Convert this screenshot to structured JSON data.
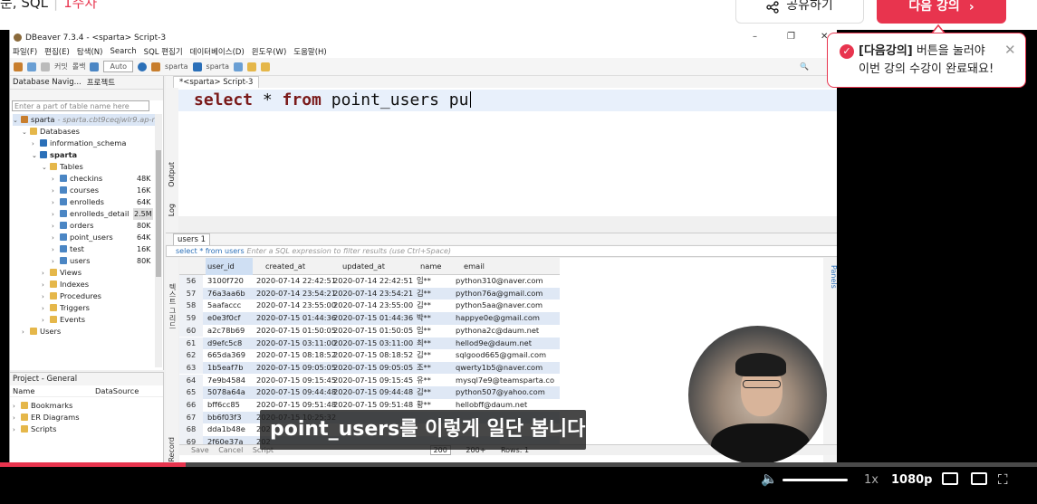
{
  "top": {
    "course_title": "문, SQL",
    "duration": "1주차",
    "share_label": "공유하기",
    "next_label": "다음 강의",
    "next_arrow": "›"
  },
  "dbeaver": {
    "window_title": "DBeaver 7.3.4 - <sparta> Script-3",
    "menu": [
      "파일(F)",
      "편집(E)",
      "탐색(N)",
      "Search",
      "SQL 편집기",
      "데이터베이스(D)",
      "윈도우(W)",
      "도움말(H)"
    ],
    "toolbar": {
      "undo": "커밋",
      "redo": "롤백",
      "auto_mode": "Auto",
      "connection": "sparta",
      "database": "sparta"
    },
    "nav_tab_label": "Database Navig...",
    "project_tab_label": "프로젝트",
    "filter_placeholder": "Enter a part of table name here",
    "tree": {
      "connection": "sparta",
      "connection_host": "- sparta.cbt9ceqjwlr9.ap-no",
      "databases": "Databases",
      "information_schema": "information_schema",
      "schema": "sparta",
      "tables": "Tables",
      "table_items": [
        {
          "name": "checkins",
          "size": "48K"
        },
        {
          "name": "courses",
          "size": "16K"
        },
        {
          "name": "enrolleds",
          "size": "64K"
        },
        {
          "name": "enrolleds_detail",
          "size": "2.5M"
        },
        {
          "name": "orders",
          "size": "80K"
        },
        {
          "name": "point_users",
          "size": "64K"
        },
        {
          "name": "test",
          "size": "16K"
        },
        {
          "name": "users",
          "size": "80K"
        }
      ],
      "views": "Views",
      "indexes": "Indexes",
      "procedures": "Procedures",
      "triggers": "Triggers",
      "events": "Events",
      "users": "Users"
    },
    "project": {
      "title": "Project - General",
      "col_name": "Name",
      "col_datasource": "DataSource",
      "items": [
        "Bookmarks",
        "ER Diagrams",
        "Scripts"
      ]
    },
    "editor": {
      "tab_label": "*<sparta> Script-3",
      "sql_kw1": "select",
      "sql_mid": " * ",
      "sql_kw2": "from",
      "sql_rest": " point_users pu",
      "side_output": "Output",
      "side_log": "Log"
    },
    "results": {
      "tab_label": "users 1",
      "filter_query": "select * from users",
      "filter_hint": "Enter a SQL expression to filter results (use Ctrl+Space)",
      "side_label": "텍스트 그리드",
      "side_record": "Record",
      "panels_label": "Panels",
      "columns": [
        "user_id",
        "created_at",
        "updated_at",
        "name",
        "email"
      ],
      "rows": [
        {
          "n": "56",
          "id": "3100f720",
          "c": "2020-07-14 22:42:51",
          "u": "2020-07-14 22:42:51",
          "name": "임**",
          "email": "python310@naver.com"
        },
        {
          "n": "57",
          "id": "76a3aa6b",
          "c": "2020-07-14 23:54:21",
          "u": "2020-07-14 23:54:21",
          "name": "김**",
          "email": "python76a@gmail.com"
        },
        {
          "n": "58",
          "id": "5aafaccc",
          "c": "2020-07-14 23:55:00",
          "u": "2020-07-14 23:55:00",
          "name": "김**",
          "email": "python5aa@naver.com"
        },
        {
          "n": "59",
          "id": "e0e3f0cf",
          "c": "2020-07-15 01:44:36",
          "u": "2020-07-15 01:44:36",
          "name": "박**",
          "email": "happye0e@gmail.com"
        },
        {
          "n": "60",
          "id": "a2c78b69",
          "c": "2020-07-15 01:50:05",
          "u": "2020-07-15 01:50:05",
          "name": "임**",
          "email": "pythona2c@daum.net"
        },
        {
          "n": "61",
          "id": "d9efc5c8",
          "c": "2020-07-15 03:11:00",
          "u": "2020-07-15 03:11:00",
          "name": "최**",
          "email": "hellod9e@daum.net"
        },
        {
          "n": "62",
          "id": "665da369",
          "c": "2020-07-15 08:18:52",
          "u": "2020-07-15 08:18:52",
          "name": "김**",
          "email": "sqlgood665@gmail.com"
        },
        {
          "n": "63",
          "id": "1b5eaf7b",
          "c": "2020-07-15 09:05:05",
          "u": "2020-07-15 09:05:05",
          "name": "조**",
          "email": "qwerty1b5@naver.com"
        },
        {
          "n": "64",
          "id": "7e9b4584",
          "c": "2020-07-15 09:15:45",
          "u": "2020-07-15 09:15:45",
          "name": "유**",
          "email": "mysql7e9@teamsparta.co"
        },
        {
          "n": "65",
          "id": "5078a64a",
          "c": "2020-07-15 09:44:48",
          "u": "2020-07-15 09:44:48",
          "name": "김**",
          "email": "python507@yahoo.com"
        },
        {
          "n": "66",
          "id": "bff6cc85",
          "c": "2020-07-15 09:51:48",
          "u": "2020-07-15 09:51:48",
          "name": "황**",
          "email": "hellobff@daum.net"
        },
        {
          "n": "67",
          "id": "bb6f03f3",
          "c": "2020-07-15 10:25:32",
          "u": "",
          "name": "",
          "email": ""
        },
        {
          "n": "68",
          "id": "dda1b48e",
          "c": "202",
          "u": "",
          "name": "",
          "email": ""
        },
        {
          "n": "69",
          "id": "2f60e37a",
          "c": "202",
          "u": "",
          "name": "",
          "email": ""
        }
      ],
      "status_save": "Save",
      "status_cancel": "Cancel",
      "status_script": "Script",
      "status_limit": "200",
      "status_fetched": "200+",
      "status_rows": "Rows: 1"
    }
  },
  "toast": {
    "bold": "[다음강의]",
    "line1": " 버튼을 눌러야",
    "line2": "이번 강의 수강이 완료돼요!"
  },
  "subtitle": "point_users를 이렇게 일단 봅니다",
  "player": {
    "progress": 0.179,
    "speed": "1x",
    "quality": "1080p"
  },
  "colors": {
    "accent": "#e8344e"
  }
}
